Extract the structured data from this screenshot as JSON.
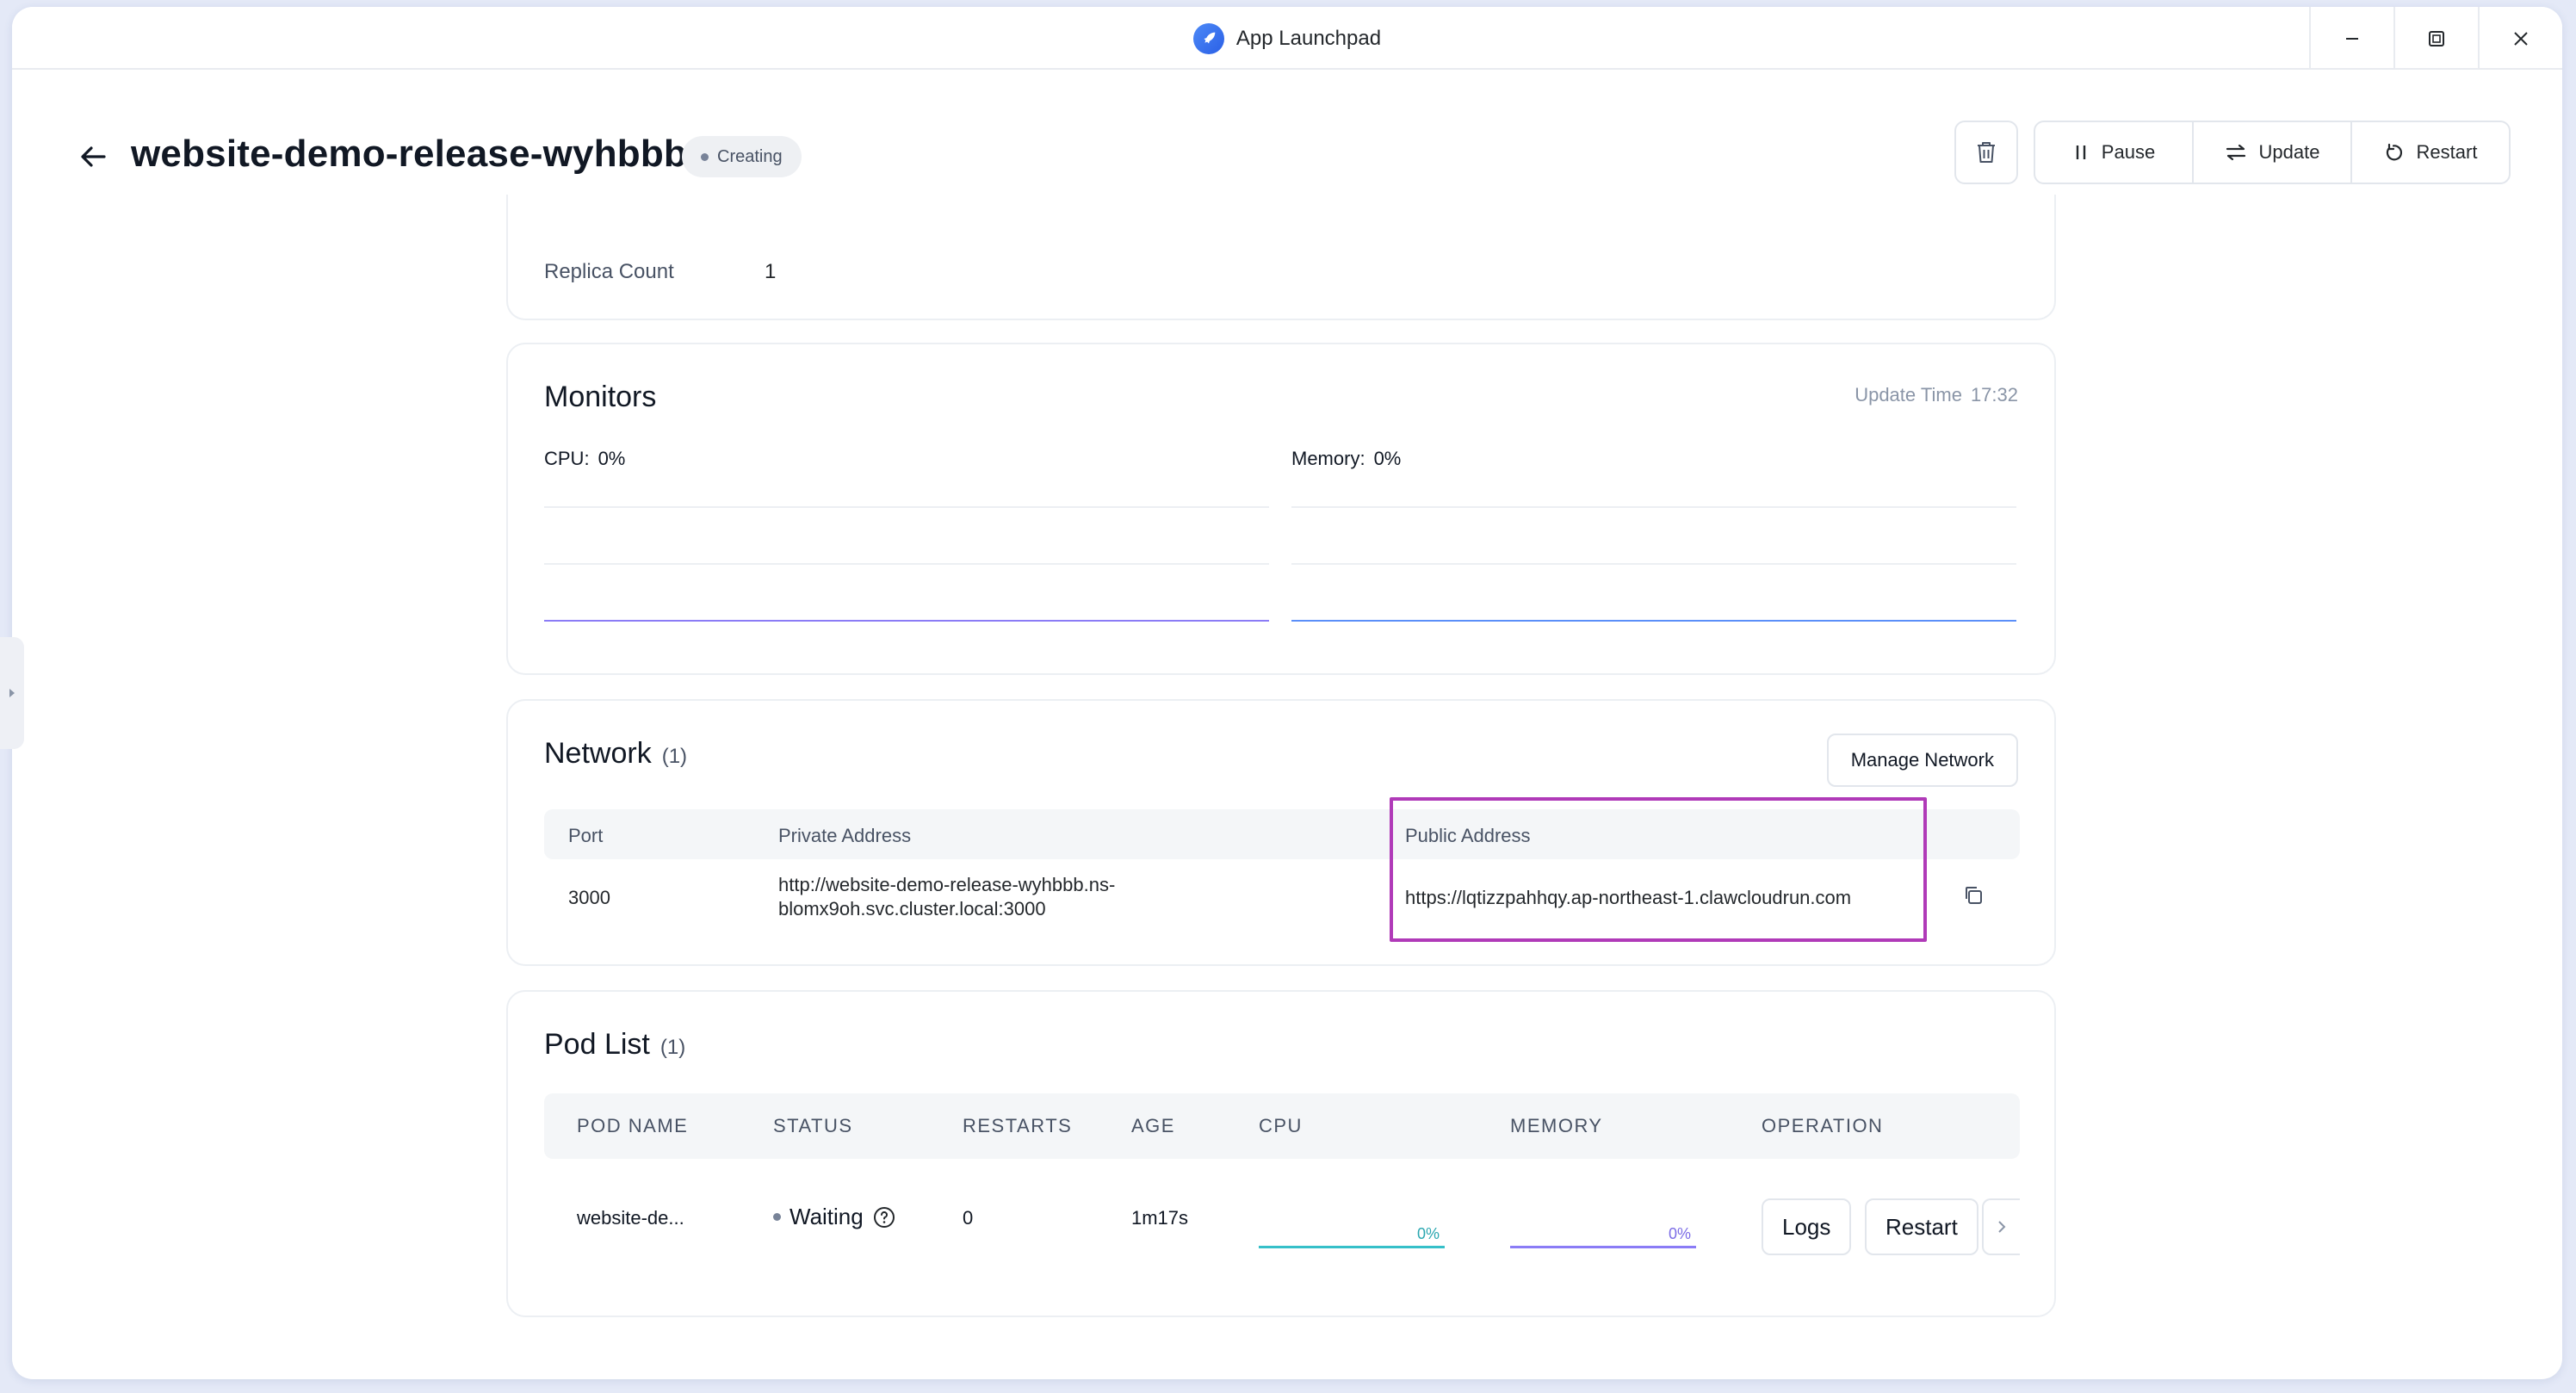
{
  "window": {
    "title": "App Launchpad"
  },
  "header": {
    "app_name": "website-demo-release-wyhbbb",
    "status": "Creating",
    "actions": {
      "pause": "Pause",
      "update": "Update",
      "restart": "Restart"
    }
  },
  "replica": {
    "label": "Replica Count",
    "value": "1"
  },
  "monitors": {
    "title": "Monitors",
    "update_time_label": "Update Time",
    "update_time_value": "17:32",
    "cpu_label": "CPU:",
    "cpu_value": "0%",
    "memory_label": "Memory:",
    "memory_value": "0%",
    "colors": {
      "cpu_line": "#8b7cf6",
      "memory_line": "#5b8ff9"
    }
  },
  "network": {
    "title": "Network",
    "count": "(1)",
    "manage_button": "Manage Network",
    "columns": [
      "Port",
      "Private Address",
      "Public Address"
    ],
    "rows": [
      {
        "port": "3000",
        "private_address_line1": "http://website-demo-release-wyhbbb.ns-",
        "private_address_line2": "blomx9oh.svc.cluster.local:3000",
        "public_address": "https://lqtizzpahhqy.ap-northeast-1.clawcloudrun.com"
      }
    ],
    "highlight_color": "#b03ab8"
  },
  "pods": {
    "title": "Pod List",
    "count": "(1)",
    "columns": [
      "POD NAME",
      "STATUS",
      "RESTARTS",
      "AGE",
      "CPU",
      "MEMORY",
      "OPERATION"
    ],
    "rows": [
      {
        "name": "website-de...",
        "status": "Waiting",
        "restarts": "0",
        "age": "1m17s",
        "cpu": "0%",
        "memory": "0%",
        "logs_button": "Logs",
        "restart_button": "Restart"
      }
    ],
    "colors": {
      "cpu_line": "#36c0c9",
      "memory_line": "#8b7cf6"
    }
  }
}
